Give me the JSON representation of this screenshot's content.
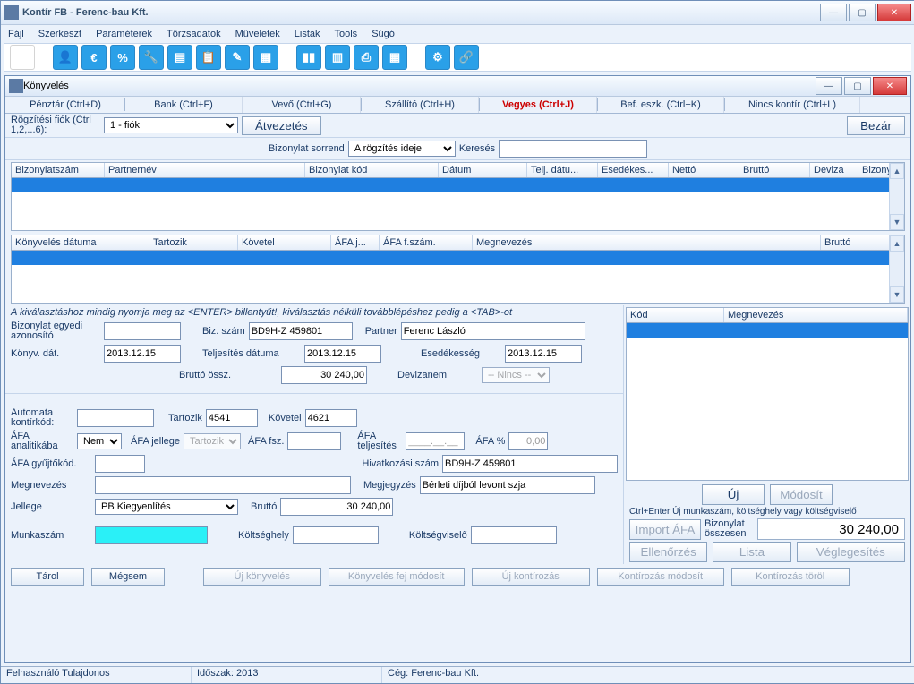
{
  "outer": {
    "title": "Kontír FB  - Ferenc-bau Kft."
  },
  "menu": [
    "Fájl",
    "Szerkeszt",
    "Paraméterek",
    "Törzsadatok",
    "Műveletek",
    "Listák",
    "Tools",
    "Súgó"
  ],
  "toolbar_icons": [
    "blank",
    "user",
    "euro",
    "percent",
    "wrench",
    "doc",
    "clip",
    "edit",
    "calc",
    "",
    "bars",
    "cal",
    "printer",
    "grid",
    "gear",
    "link"
  ],
  "inner": {
    "title": "Könyvelés"
  },
  "tabs": [
    {
      "label": "Pénztár (Ctrl+D)"
    },
    {
      "label": "Bank (Ctrl+F)"
    },
    {
      "label": "Vevő (Ctrl+G)"
    },
    {
      "label": "Szállító (Ctrl+H)"
    },
    {
      "label": "Vegyes (Ctrl+J)",
      "sel": true
    },
    {
      "label": "Bef. eszk. (Ctrl+K)"
    },
    {
      "label": "Nincs kontír (Ctrl+L)"
    }
  ],
  "fiok_label": "Rögzítési fiók (Ctrl 1,2,...6):",
  "fiok_value": "1 - fiók",
  "atvezetes": "Átvezetés",
  "bezar": "Bezár",
  "sorrend_label": "Bizonylat sorrend",
  "sorrend_value": "A rögzítés ideje",
  "kereses": "Keresés",
  "grid1_cols": [
    "Bizonylatszám",
    "Partnernév",
    "Bizonylat kód",
    "Dátum",
    "Telj. dátu...",
    "Esedékes...",
    "Nettó",
    "Bruttó",
    "Deviza",
    "Bizonylat ös..."
  ],
  "grid2_cols": [
    "Könyvelés dátuma",
    "Tartozik",
    "Követel",
    "ÁFA j...",
    "ÁFA f.szám.",
    "Megnevezés",
    "Bruttó"
  ],
  "help": "A kiválasztáshoz mindig nyomja meg az <ENTER> billentyűt!, kiválasztás nélküli továbblépéshez pedig a <TAB>-ot",
  "f": {
    "biz_egyedi": "Bizonylat egyedi azonosító",
    "biz_szam_l": "Biz. szám",
    "biz_szam_v": "BD9H-Z 459801",
    "partner_l": "Partner",
    "partner_v": "Ferenc László",
    "konyv_dat_l": "Könyv. dát.",
    "konyv_dat_v": "2013.12.15",
    "telj_l": "Teljesítés dátuma",
    "telj_v": "2013.12.15",
    "esed_l": "Esedékesség",
    "esed_v": "2013.12.15",
    "brutto_l": "Bruttó össz.",
    "brutto_v": "30 240,00",
    "deviza_l": "Devizanem",
    "deviza_v": "-- Nincs --",
    "auto_l": "Automata kontírkód:",
    "tartozik_l": "Tartozik",
    "tartozik_v": "4541",
    "kovetel_l": "Követel",
    "kovetel_v": "4621",
    "afa_anal_l": "ÁFA analitikába",
    "afa_anal_v": "Nem",
    "afa_jelleg_l": "ÁFA jellege",
    "afa_jelleg_v": "Tartozik",
    "afa_fsz_l": "ÁFA fsz.",
    "afa_telj_l": "ÁFA teljesítés",
    "afa_telj_v": "____.__.__",
    "afa_pct_l": "ÁFA %",
    "afa_pct_v": "0,00",
    "afa_gyujto_l": "ÁFA gyűjtőkód.",
    "hiv_l": "Hivatkozási szám",
    "hiv_v": "BD9H-Z 459801",
    "megnev_l": "Megnevezés",
    "megjegy_l": "Megjegyzés",
    "megjegy_v": "Bérleti díjból levont szja",
    "jelleg_l": "Jellege",
    "jelleg_v": "PB Kiegyenlítés",
    "brutto2_l": "Bruttó",
    "brutto2_v": "30 240,00",
    "munkaszam_l": "Munkaszám",
    "koltseghely_l": "Költséghely",
    "koltsegviselo_l": "Költségviselő"
  },
  "right_cols": [
    "Kód",
    "Megnevezés"
  ],
  "rbtn": {
    "uj": "Új",
    "modosit": "Módosít",
    "tip": "Ctrl+Enter Új munkaszám, költséghely vagy költségviselő",
    "import": "Import ÁFA",
    "osszesen_l": "Bizonylat összesen",
    "osszesen_v": "30 240,00",
    "ellen": "Ellenőrzés",
    "lista": "Lista",
    "vegleg": "Véglegesítés"
  },
  "bottom": [
    "Tárol",
    "Mégsem",
    "Új könyvelés",
    "Könyvelés fej módosít",
    "Új kontírozás",
    "Kontírozás módosít",
    "Kontírozás töröl"
  ],
  "status": {
    "user": "Felhasználó Tulajdonos",
    "idoszak": "Időszak: 2013",
    "ceg": "Cég: Ferenc-bau Kft."
  }
}
